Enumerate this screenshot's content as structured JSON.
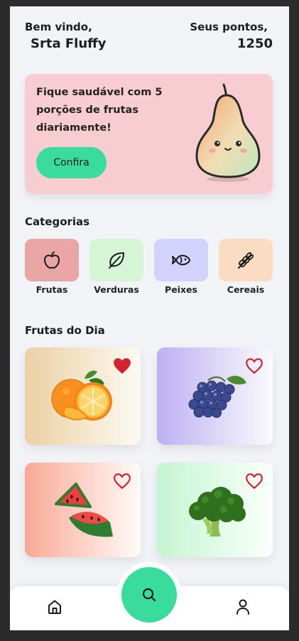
{
  "header": {
    "greeting": "Bem vindo,",
    "username": "Srta Fluffy",
    "points_label": "Seus pontos,",
    "points_value": "1250"
  },
  "banner": {
    "text": "Fique saudável com 5 porções de frutas diariamente!",
    "button_label": "Confira",
    "illustration": "pear-character",
    "background": "#f7cdd1"
  },
  "categories": {
    "title": "Categorias",
    "items": [
      {
        "label": "Frutas",
        "icon": "apple-icon",
        "color": "#eaa5a5"
      },
      {
        "label": "Verduras",
        "icon": "leaf-icon",
        "color": "#d5f5d5"
      },
      {
        "label": "Peixes",
        "icon": "fish-icon",
        "color": "#d2d2fd"
      },
      {
        "label": "Cereais",
        "icon": "wheat-icon",
        "color": "#f9dcc1"
      }
    ]
  },
  "fruits": {
    "title": "Frutas do Dia",
    "items": [
      {
        "name": "orange",
        "favorite": true
      },
      {
        "name": "grapes",
        "favorite": false
      },
      {
        "name": "watermelon",
        "favorite": false
      },
      {
        "name": "broccoli",
        "favorite": false
      }
    ]
  },
  "nav": {
    "items": [
      "home-icon",
      "search-icon",
      "profile-icon"
    ],
    "accent": "#39dc9c"
  },
  "colors": {
    "accent": "#39dc9c",
    "heart": "#d2232f",
    "background": "#f2f3f7"
  }
}
